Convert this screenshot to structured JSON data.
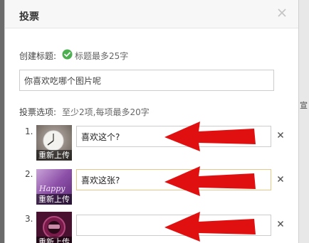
{
  "dialog": {
    "title": "投票",
    "close_icon": "close-icon"
  },
  "title_field": {
    "label": "创建标题:",
    "hint_icon": "check-circle-icon",
    "hint": "标题最多25字",
    "value": "你喜欢吃哪个图片呢"
  },
  "options_section": {
    "label": "投票选项:",
    "hint": "至少2项,每项最多20字"
  },
  "options": [
    {
      "number": "1.",
      "reupload_label": "重新上传",
      "value": "喜欢这个?",
      "remove_icon": "remove-x-icon",
      "thumb": "clock-thumbnail",
      "focused": false
    },
    {
      "number": "2.",
      "reupload_label": "重新上传",
      "value": "喜欢这张?",
      "remove_icon": "remove-x-icon",
      "thumb": "purple-happy-thumbnail",
      "focused": true
    },
    {
      "number": "3.",
      "reupload_label": "重新上传",
      "value": "",
      "remove_icon": "remove-x-icon",
      "thumb": "dark-round-thumbnail",
      "focused": false
    }
  ],
  "annotations": {
    "arrow_icon": "red-arrow-icon",
    "arrow_color": "#e01010"
  },
  "colors": {
    "focus_border": "#e7c987",
    "hint_green": "#4caf50",
    "header_bg": "#f7f7f7"
  },
  "right_sliver_text": "宣"
}
